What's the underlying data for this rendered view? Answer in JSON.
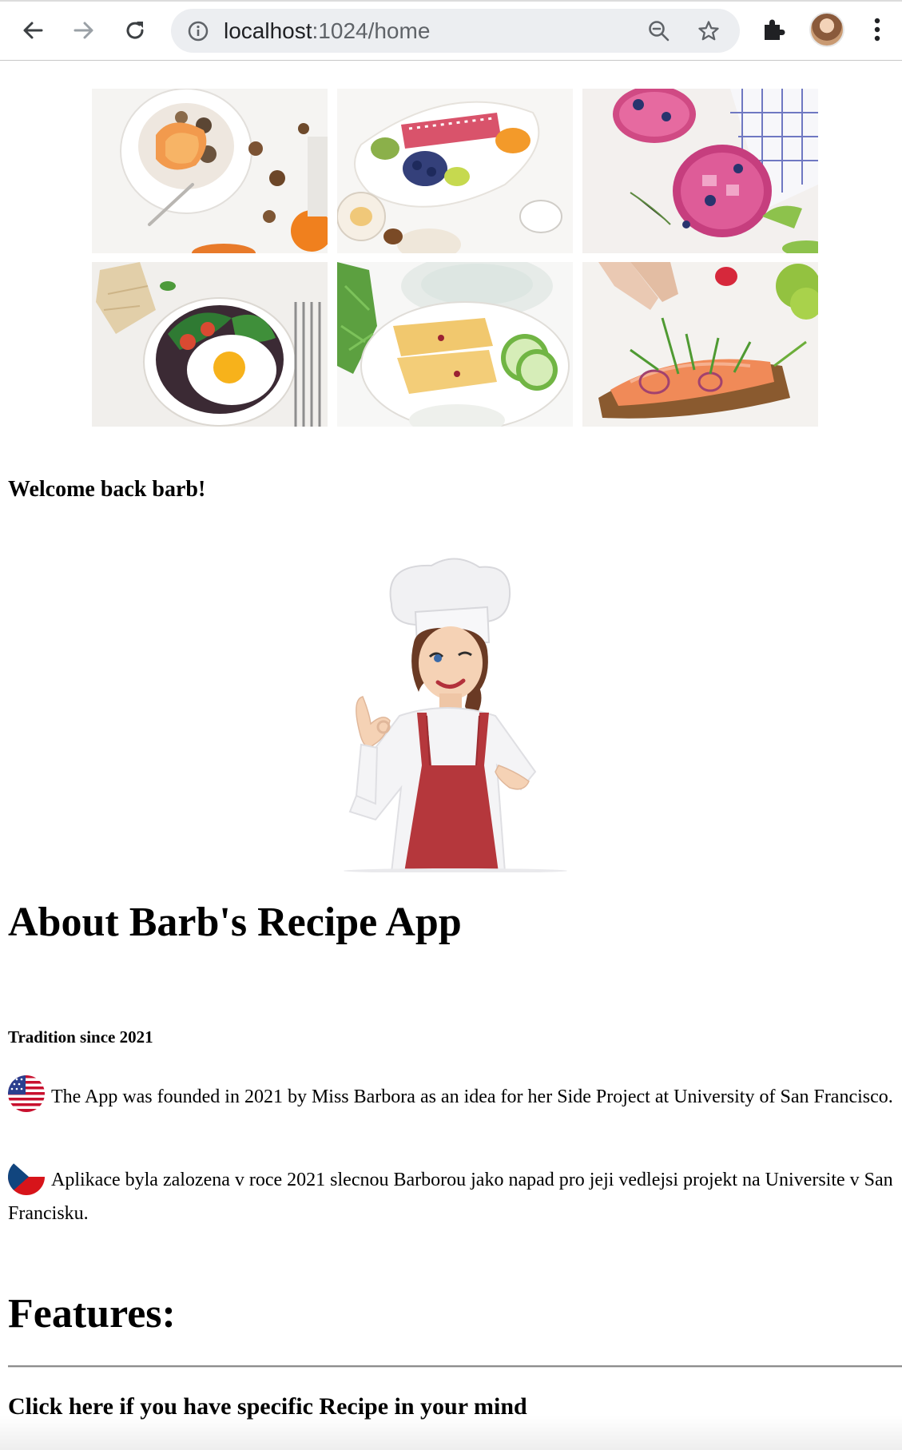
{
  "browser": {
    "url_host": "localhost",
    "url_path": ":1024/home",
    "icons": [
      "back-arrow-icon",
      "forward-arrow-icon",
      "reload-icon",
      "info-icon",
      "zoom-out-icon",
      "star-icon",
      "extensions-puzzle-icon",
      "profile-avatar",
      "kebab-menu-icon"
    ]
  },
  "gallery": {
    "images": [
      {
        "name": "granola-peach-bowl-photo"
      },
      {
        "name": "fruit-platter-photo"
      },
      {
        "name": "berry-drinks-photo"
      },
      {
        "name": "egg-salad-photo"
      },
      {
        "name": "bread-cucumber-dip-photo"
      },
      {
        "name": "salmon-toast-photo"
      }
    ]
  },
  "welcome": "Welcome back barb!",
  "about": {
    "title": "About Barb's Recipe App",
    "subtitle": "Tradition since 2021",
    "paragraph_en": "The App was founded in 2021 by Miss Barbora as an idea for her Side Project at University of San Francisco.",
    "paragraph_cz": "Aplikace byla zalozena v roce 2021 slecnou Barborou jako napad pro jeji vedlejsi projekt na Universite v San Francisku."
  },
  "features": {
    "title": "Features:",
    "cta": "Click here if you have specific Recipe in your mind"
  },
  "colors": {
    "apron_red": "#b5373c",
    "flag_us_red": "#c8102e",
    "flag_us_blue": "#2b3f8f",
    "flag_cz_red": "#d7141a",
    "flag_cz_blue": "#11457e"
  }
}
